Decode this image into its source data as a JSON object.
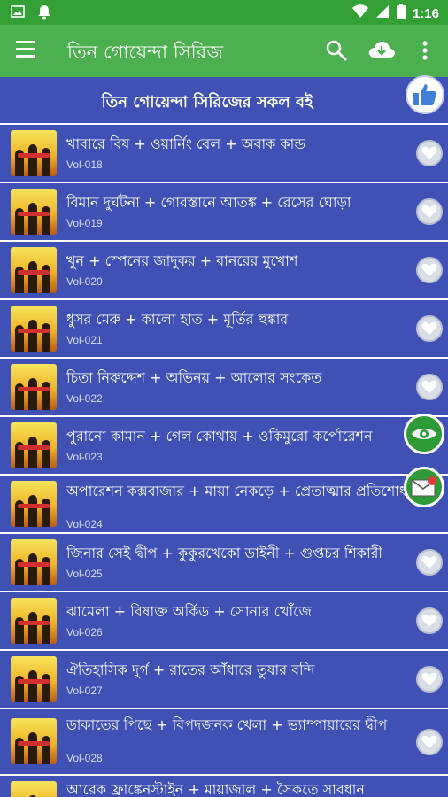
{
  "status_bar": {
    "time": "1:16"
  },
  "app_bar": {
    "title": "তিন গোয়েন্দা সিরিজ"
  },
  "section": {
    "title": "তিন গোয়েন্দা সিরিজের সকল বই"
  },
  "books": [
    {
      "title": "খাবারে বিষ + ওয়ার্নিং বেল + অবাক কান্ড",
      "vol": "Vol-018"
    },
    {
      "title": "বিমান দুর্ঘটনা + গোরস্তানে আতঙ্ক + রেসের ঘোড়া",
      "vol": "Vol-019"
    },
    {
      "title": "খুন + স্পেনের জাদুকর + বানরের মুখোশ",
      "vol": "Vol-020"
    },
    {
      "title": "ধুসর মেরু + কালো হাত + মূর্তির হুঙ্কার",
      "vol": "Vol-021"
    },
    {
      "title": "চিতা নিরুদ্দেশ + অভিনয় + আলোর সংকেত",
      "vol": "Vol-022"
    },
    {
      "title": "পুরানো কামান + গেল কোথায় + ওকিমুরো কর্পোরেশন",
      "vol": "Vol-023"
    },
    {
      "title": "অপারেশন কক্সবাজার + মায়া নেকড়ে + প্রেতাত্মার প্রতিশোধ",
      "vol": "Vol-024"
    },
    {
      "title": "জিনার সেই দ্বীপ + কুকুরখেকো ডাইনী + গুপ্তচর শিকারী",
      "vol": "Vol-025"
    },
    {
      "title": "ঝামেলা + বিষাক্ত অর্কিড + সোনার খোঁজে",
      "vol": "Vol-026"
    },
    {
      "title": "ঐতিহাসিক দুর্গ + রাতের আঁধারে তুষার বন্দি",
      "vol": "Vol-027"
    },
    {
      "title": "ডাকাতের পিছে + বিপদজনক খেলা + ভ্যাম্পায়ারের দ্বীপ",
      "vol": "Vol-028"
    },
    {
      "title": "আরেক ফ্রাঙ্কেনস্টাইন + মায়াজাল + সৈকতে সাবধান",
      "vol": ""
    }
  ],
  "icons": {
    "menu": "menu-icon",
    "search": "search-icon",
    "download": "cloud-download-icon",
    "more": "more-vert-icon",
    "like": "thumbs-up-icon",
    "favorite": "heart-icon",
    "eye": "eye-icon",
    "mail": "mail-icon"
  },
  "colors": {
    "status_bar": "#33a036",
    "app_bar": "#4caf50",
    "list_bg": "#3f51b5",
    "divider": "#ffffff"
  }
}
